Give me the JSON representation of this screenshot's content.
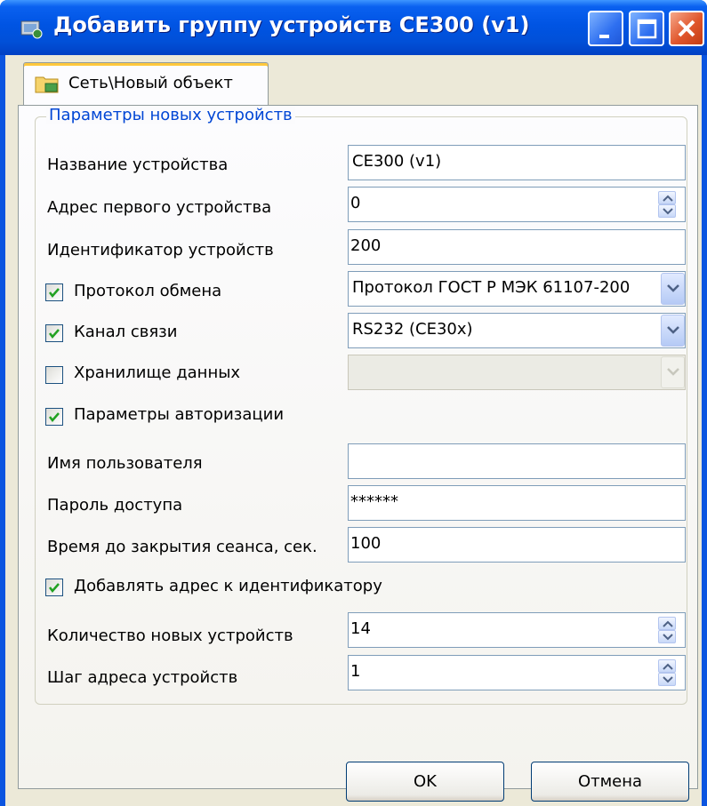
{
  "window": {
    "title": "Добавить группу устройств CE300 (v1)"
  },
  "tab": {
    "label": "Сеть\\Новый объект"
  },
  "group": {
    "title": "Параметры новых устройств"
  },
  "fields": {
    "device_name": {
      "label": "Название устройства",
      "value": "CE300 (v1)"
    },
    "first_address": {
      "label": "Адрес первого устройства",
      "value": "0"
    },
    "device_id": {
      "label": "Идентификатор устройств",
      "value": "200"
    },
    "protocol": {
      "label": "Протокол обмена",
      "checked": true,
      "value": "Протокол ГОСТ Р МЭК 61107-200"
    },
    "channel": {
      "label": "Канал связи",
      "checked": true,
      "value": "RS232 (CE30x)"
    },
    "storage": {
      "label": "Хранилище данных",
      "checked": false,
      "value": ""
    },
    "auth": {
      "label": "Параметры авторизации",
      "checked": true
    },
    "username": {
      "label": "Имя пользователя",
      "value": ""
    },
    "password": {
      "label": "Пароль доступа",
      "value": "******"
    },
    "session_timeout": {
      "label": "Время до закрытия сеанса, сек.",
      "value": "100"
    },
    "append_address": {
      "label": "Добавлять адрес к идентификатору",
      "checked": true
    },
    "device_count": {
      "label": "Количество новых устройств",
      "value": "14"
    },
    "address_step": {
      "label": "Шаг адреса устройств",
      "value": "1"
    }
  },
  "buttons": {
    "ok": "OK",
    "cancel": "Отмена"
  },
  "icons": {
    "title": "device-group-icon",
    "tab": "folder-network-icon",
    "minimize": "minimize-icon",
    "maximize": "maximize-icon",
    "close": "close-icon"
  },
  "colors": {
    "titlebar": "#0054e3",
    "group_title": "#0046d5",
    "close_button": "#e0562c",
    "tab_highlight": "#ffc83c"
  }
}
